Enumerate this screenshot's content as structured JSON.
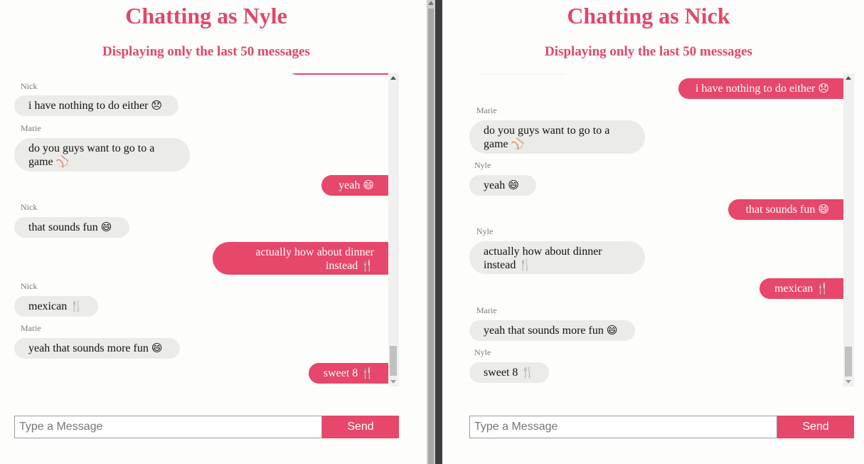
{
  "left": {
    "title": "Chatting as Nyle",
    "subtitle": "Displaying only the last 50 messages",
    "messages": [
      {
        "sender": "Nick",
        "text": "i have nothing to do either",
        "emoji": "😞"
      },
      {
        "sender": "Marie",
        "text": "do you guys want to go to a game",
        "emoji": "⚾"
      },
      {
        "text": "yeah",
        "emoji": "😄"
      },
      {
        "sender": "Nick",
        "text": "that sounds fun",
        "emoji": "😄"
      },
      {
        "text": "actually how about dinner instead",
        "emoji": "🍴"
      },
      {
        "sender": "Nick",
        "text": "mexican",
        "emoji": "🍴"
      },
      {
        "sender": "Marie",
        "text": "yeah that sounds more fun",
        "emoji": "😄"
      },
      {
        "text": "sweet 8",
        "emoji": "🍴"
      }
    ],
    "input": {
      "placeholder": "Type a Message",
      "value": ""
    },
    "send_label": "Send"
  },
  "right": {
    "title": "Chatting as Nick",
    "subtitle": "Displaying only the last 50 messages",
    "messages": [
      {
        "text": "i have nothing to do either",
        "emoji": "😞"
      },
      {
        "sender": "Marie",
        "text": "do you guys want to go to a game",
        "emoji": "⚾"
      },
      {
        "sender": "Nyle",
        "text": "yeah",
        "emoji": "😄"
      },
      {
        "text": "that sounds fun",
        "emoji": "😄"
      },
      {
        "sender": "Nyle",
        "text": "actually how about dinner instead",
        "emoji": "🍴"
      },
      {
        "text": "mexican",
        "emoji": "🍴"
      },
      {
        "sender": "Marie",
        "text": "yeah that sounds more fun",
        "emoji": "😄"
      },
      {
        "sender": "Nyle",
        "text": "sweet 8",
        "emoji": "🍴"
      }
    ],
    "input": {
      "placeholder": "Type a Message",
      "value": ""
    },
    "send_label": "Send"
  },
  "colors": {
    "accent": "#e6476a",
    "incoming_bubble": "#ebebe8",
    "background": "#fdfdfb"
  }
}
